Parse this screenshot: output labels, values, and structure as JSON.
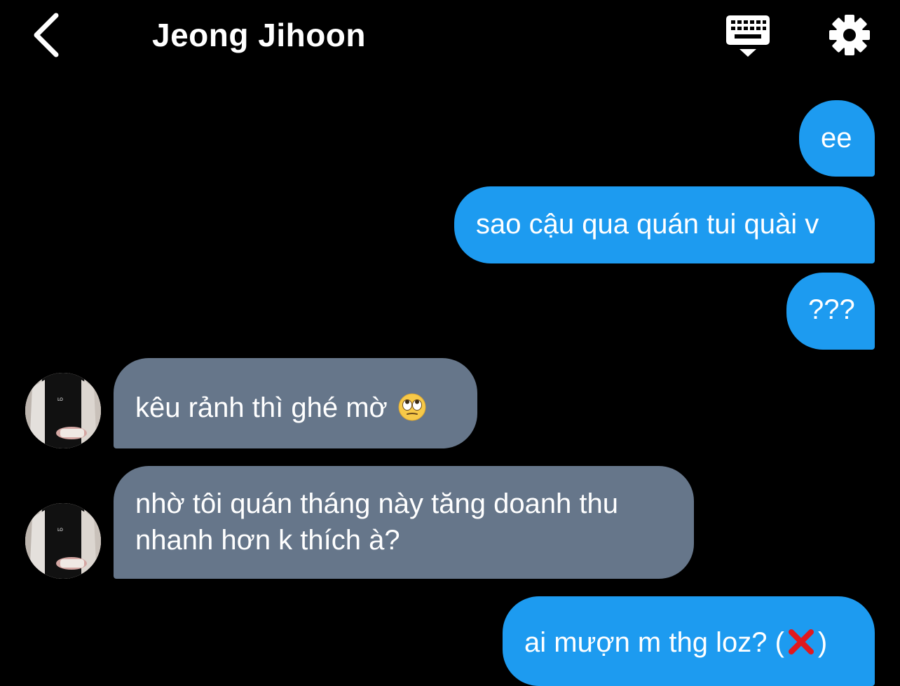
{
  "header": {
    "title": "Jeong Jihoon",
    "back_icon": "chevron-left-icon",
    "keyboard_icon": "keyboard-icon",
    "settings_icon": "gear-icon"
  },
  "colors": {
    "background": "#000000",
    "sent_bubble": "#1d9bf0",
    "received_bubble": "#66768a",
    "text": "#ffffff"
  },
  "messages": [
    {
      "direction": "sent",
      "text": "ee"
    },
    {
      "direction": "sent",
      "text": "sao cậu qua quán tui quài v"
    },
    {
      "direction": "sent",
      "text": "???"
    },
    {
      "direction": "received",
      "text": "kêu rảnh thì ghé mờ",
      "emoji": "eye-roll-emoji"
    },
    {
      "direction": "received",
      "text": "nhờ tôi quán tháng này tăng doanh thu nhanh hơn k thích à?"
    },
    {
      "direction": "sent",
      "text_before": "ai mượn m thg loz? (",
      "emoji": "cross-mark-emoji",
      "text_after": ")"
    }
  ]
}
